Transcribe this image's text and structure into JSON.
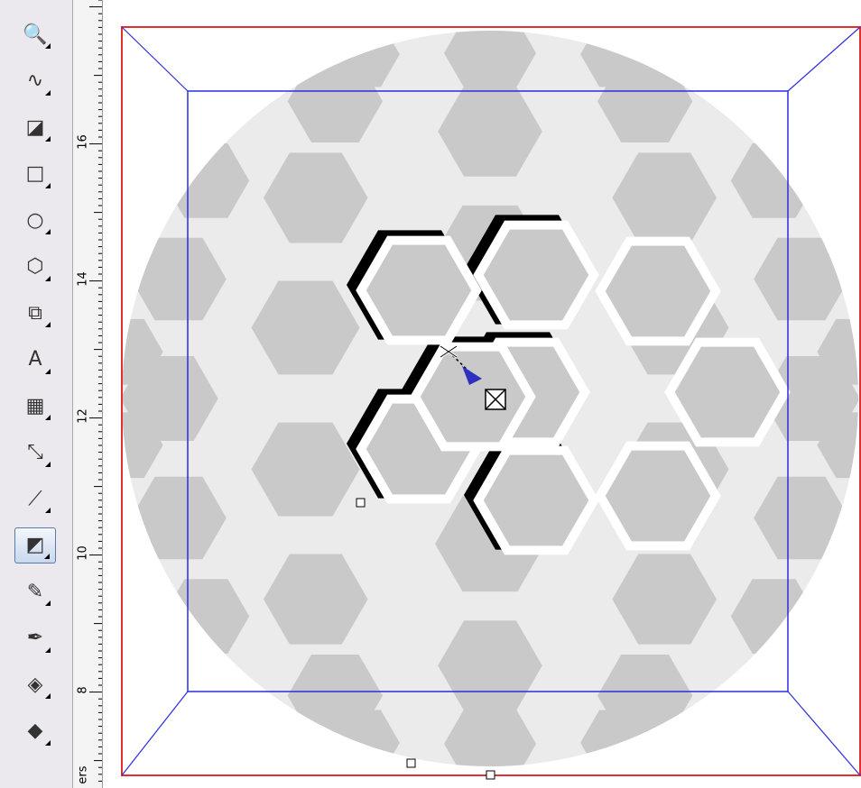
{
  "toolbar": {
    "tools": [
      {
        "name": "zoom-tool",
        "icon": "magnifier-icon",
        "glyph": "🔍",
        "active": false
      },
      {
        "name": "freehand-tool",
        "icon": "freehand-curve-icon",
        "glyph": "∿",
        "active": false
      },
      {
        "name": "smart-fill-tool",
        "icon": "smart-fill-icon",
        "glyph": "◪",
        "active": false
      },
      {
        "name": "rectangle-tool",
        "icon": "rectangle-icon",
        "glyph": "□",
        "active": false
      },
      {
        "name": "ellipse-tool",
        "icon": "ellipse-icon",
        "glyph": "○",
        "active": false
      },
      {
        "name": "polygon-tool",
        "icon": "hexagon-icon",
        "glyph": "⬡",
        "active": false
      },
      {
        "name": "basic-shapes-tool",
        "icon": "basic-shapes-icon",
        "glyph": "⧉",
        "active": false
      },
      {
        "name": "text-tool",
        "icon": "text-a-icon",
        "glyph": "A",
        "active": false
      },
      {
        "name": "table-tool",
        "icon": "table-grid-icon",
        "glyph": "▦",
        "active": false
      },
      {
        "name": "dimension-tool",
        "icon": "dimension-icon",
        "glyph": "⤡",
        "active": false
      },
      {
        "name": "connector-tool",
        "icon": "connector-icon",
        "glyph": "⟋",
        "active": false
      },
      {
        "name": "extrude-tool",
        "icon": "extrude-cube-icon",
        "glyph": "◩",
        "active": true
      },
      {
        "name": "eyedropper-tool",
        "icon": "eyedropper-icon",
        "glyph": "✎",
        "active": false
      },
      {
        "name": "outline-pen-tool",
        "icon": "pen-nib-icon",
        "glyph": "✒",
        "active": false
      },
      {
        "name": "fill-tool",
        "icon": "paint-bucket-icon",
        "glyph": "◈",
        "active": false
      },
      {
        "name": "interactive-fill-tool",
        "icon": "interactive-fill-icon",
        "glyph": "◆",
        "active": false
      }
    ]
  },
  "ruler": {
    "labels": [
      "16",
      "14",
      "12",
      "10",
      "8"
    ],
    "unit_fragment": "ers"
  },
  "colors": {
    "toolbar_bg": "#ebe9ed",
    "hex_fill": "#c9c9c9",
    "sphere_fill": "#ebebeb",
    "page_border": "#e03030",
    "extrude_box": "#2b2be0",
    "vanishing_point": "#3030c0"
  }
}
